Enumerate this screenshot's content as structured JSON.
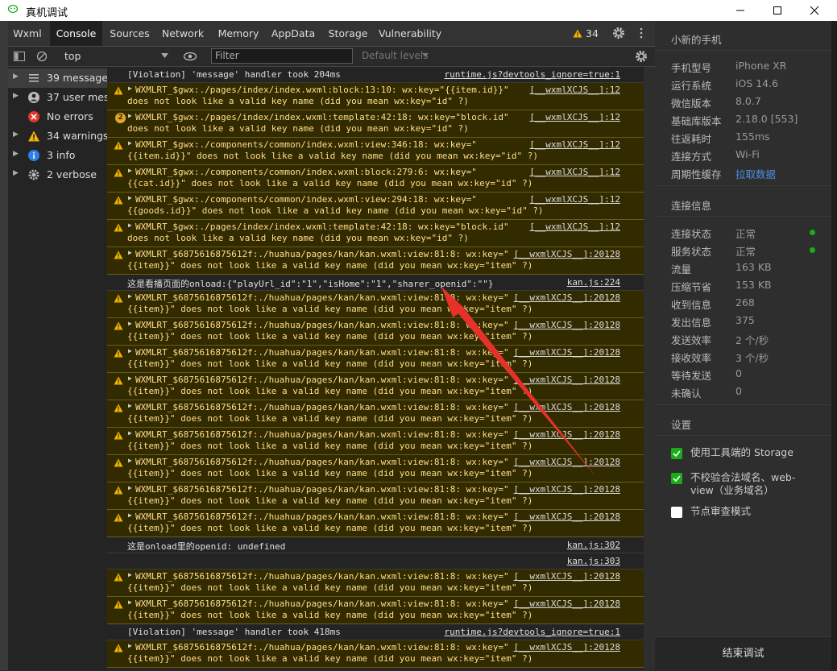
{
  "window": {
    "title": "真机调试"
  },
  "tabs": [
    {
      "label": "Wxml"
    },
    {
      "label": "Console"
    },
    {
      "label": "Sources"
    },
    {
      "label": "Network"
    },
    {
      "label": "Memory"
    },
    {
      "label": "AppData"
    },
    {
      "label": "Storage"
    },
    {
      "label": "Vulnerability"
    }
  ],
  "warning_badge": "34",
  "toolbar": {
    "context": "top",
    "filter_placeholder": "Filter",
    "levels": "Default levels"
  },
  "sidebar": [
    {
      "label": "39 messages",
      "icon": "list-icon"
    },
    {
      "label": "37 user mes...",
      "icon": "user-icon"
    },
    {
      "label": "No errors",
      "icon": "error-icon"
    },
    {
      "label": "34 warnings",
      "icon": "warning-icon"
    },
    {
      "label": "3 info",
      "icon": "info-icon"
    },
    {
      "label": "2 verbose",
      "icon": "gear-icon"
    }
  ],
  "console": [
    {
      "type": "plain",
      "text": "[Violation] 'message' handler took 204ms",
      "src": "runtime.js?devtools_ignore=true:1"
    },
    {
      "type": "warn",
      "line1": "WXMLRT_$gwx:./pages/index/index.wxml:block:13:10: wx:key=\"{{item.id}}\"",
      "line2": "does not look like a valid key name (did you mean wx:key=\"id\" ?)",
      "src": "[__wxmlXCJS__]:12"
    },
    {
      "type": "warn2",
      "badge": "2",
      "line1": "WXMLRT_$gwx:./pages/index/index.wxml:template:42:18: wx:key=\"block.id\"",
      "line2": "does not look like a valid key name (did you mean wx:key=\"id\" ?)",
      "src": "[__wxmlXCJS__]:12"
    },
    {
      "type": "warn",
      "line1": "WXMLRT_$gwx:./components/common/index.wxml:view:346:18: wx:key=\"",
      "line2": "{{item.id}}\" does not look like a valid key name (did you mean wx:key=\"id\" ?)",
      "src": "[__wxmlXCJS__]:12"
    },
    {
      "type": "warn",
      "line1": "WXMLRT_$gwx:./components/common/index.wxml:block:279:6: wx:key=\"",
      "line2": "{{cat.id}}\" does not look like a valid key name (did you mean wx:key=\"id\" ?)",
      "src": "[__wxmlXCJS__]:12"
    },
    {
      "type": "warn",
      "line1": "WXMLRT_$gwx:./components/common/index.wxml:view:294:18: wx:key=\"",
      "line2": "{{goods.id}}\" does not look like a valid key name (did you mean wx:key=\"id\" ?)",
      "src": "[__wxmlXCJS__]:12"
    },
    {
      "type": "warn",
      "line1": "WXMLRT_$gwx:./pages/index/index.wxml:template:42:18: wx:key=\"block.id\"",
      "line2": "does not look like a valid key name (did you mean wx:key=\"id\" ?)",
      "src": "[__wxmlXCJS__]:12"
    },
    {
      "type": "warn",
      "line1": "WXMLRT_$6875616875612f:./huahua/pages/kan/kan.wxml:view:81:8: wx:key=\"",
      "line2": "{{item}}\" does not look like a valid key name (did you mean wx:key=\"item\" ?)",
      "src": "[__wxmlXCJS__]:20128"
    },
    {
      "type": "plain",
      "text": "这是看播页面的onload:{\"playUrl_id\":\"1\",\"isHome\":\"1\",\"sharer_openid\":\"\"}",
      "src": "kan.js:224"
    },
    {
      "type": "warn",
      "line1": "WXMLRT_$6875616875612f:./huahua/pages/kan/kan.wxml:view:81:8: wx:key=\"",
      "line2": "{{item}}\" does not look like a valid key name (did you mean wx:key=\"item\" ?)",
      "src": "[__wxmlXCJS__]:20128"
    },
    {
      "type": "warn",
      "line1": "WXMLRT_$6875616875612f:./huahua/pages/kan/kan.wxml:view:81:8: wx:key=\"",
      "line2": "{{item}}\" does not look like a valid key name (did you mean wx:key=\"item\" ?)",
      "src": "[__wxmlXCJS__]:20128"
    },
    {
      "type": "warn",
      "line1": "WXMLRT_$6875616875612f:./huahua/pages/kan/kan.wxml:view:81:8: wx:key=\"",
      "line2": "{{item}}\" does not look like a valid key name (did you mean wx:key=\"item\" ?)",
      "src": "[__wxmlXCJS__]:20128"
    },
    {
      "type": "warn",
      "line1": "WXMLRT_$6875616875612f:./huahua/pages/kan/kan.wxml:view:81:8: wx:key=\"",
      "line2": "{{item}}\" does not look like a valid key name (did you mean wx:key=\"item\" ?)",
      "src": "[__wxmlXCJS__]:20128"
    },
    {
      "type": "warn",
      "line1": "WXMLRT_$6875616875612f:./huahua/pages/kan/kan.wxml:view:81:8: wx:key=\"",
      "line2": "{{item}}\" does not look like a valid key name (did you mean wx:key=\"item\" ?)",
      "src": "[__wxmlXCJS__]:20128"
    },
    {
      "type": "warn",
      "line1": "WXMLRT_$6875616875612f:./huahua/pages/kan/kan.wxml:view:81:8: wx:key=\"",
      "line2": "{{item}}\" does not look like a valid key name (did you mean wx:key=\"item\" ?)",
      "src": "[__wxmlXCJS__]:20128"
    },
    {
      "type": "warn",
      "line1": "WXMLRT_$6875616875612f:./huahua/pages/kan/kan.wxml:view:81:8: wx:key=\"",
      "line2": "{{item}}\" does not look like a valid key name (did you mean wx:key=\"item\" ?)",
      "src": "[__wxmlXCJS__]:20128"
    },
    {
      "type": "warn",
      "line1": "WXMLRT_$6875616875612f:./huahua/pages/kan/kan.wxml:view:81:8: wx:key=\"",
      "line2": "{{item}}\" does not look like a valid key name (did you mean wx:key=\"item\" ?)",
      "src": "[__wxmlXCJS__]:20128"
    },
    {
      "type": "warn",
      "line1": "WXMLRT_$6875616875612f:./huahua/pages/kan/kan.wxml:view:81:8: wx:key=\"",
      "line2": "{{item}}\" does not look like a valid key name (did you mean wx:key=\"item\" ?)",
      "src": "[__wxmlXCJS__]:20128"
    },
    {
      "type": "plain",
      "text": "这是onload里的openid: undefined",
      "src": "kan.js:302"
    },
    {
      "type": "plain",
      "text": "",
      "src": "kan.js:303"
    },
    {
      "type": "warn",
      "line1": "WXMLRT_$6875616875612f:./huahua/pages/kan/kan.wxml:view:81:8: wx:key=\"",
      "line2": "{{item}}\" does not look like a valid key name (did you mean wx:key=\"item\" ?)",
      "src": "[__wxmlXCJS__]:20128"
    },
    {
      "type": "warn",
      "line1": "WXMLRT_$6875616875612f:./huahua/pages/kan/kan.wxml:view:81:8: wx:key=\"",
      "line2": "{{item}}\" does not look like a valid key name (did you mean wx:key=\"item\" ?)",
      "src": "[__wxmlXCJS__]:20128"
    },
    {
      "type": "plain",
      "text": "[Violation] 'message' handler took 418ms",
      "src": "runtime.js?devtools_ignore=true:1"
    },
    {
      "type": "warn",
      "line1": "WXMLRT_$6875616875612f:./huahua/pages/kan/kan.wxml:view:81:8: wx:key=\"",
      "line2": "{{item}}\" does not look like a valid key name (did you mean wx:key=\"item\" ?)",
      "src": "[__wxmlXCJS__]:20128"
    }
  ],
  "panel": {
    "device_title": "小新的手机",
    "info": [
      {
        "k": "手机型号",
        "v": "iPhone XR"
      },
      {
        "k": "运行系统",
        "v": "iOS 14.6"
      },
      {
        "k": "微信版本",
        "v": "8.0.7"
      },
      {
        "k": "基础库版本",
        "v": "2.18.0 [553]"
      },
      {
        "k": "往返耗时",
        "v": "155ms"
      },
      {
        "k": "连接方式",
        "v": "Wi-Fi"
      },
      {
        "k": "周期性缓存",
        "v": "拉取数据",
        "link": true
      }
    ],
    "conn_title": "连接信息",
    "conn": [
      {
        "k": "连接状态",
        "v": "正常",
        "dot": true
      },
      {
        "k": "服务状态",
        "v": "正常",
        "dot": true
      },
      {
        "k": "流量",
        "v": "163 KB"
      },
      {
        "k": "压缩节省",
        "v": "153 KB"
      },
      {
        "k": "收到信息",
        "v": "268"
      },
      {
        "k": "发出信息",
        "v": "375"
      },
      {
        "k": "发送效率",
        "v": "2 个/秒"
      },
      {
        "k": "接收效率",
        "v": "3 个/秒"
      },
      {
        "k": "等待发送",
        "v": "0"
      },
      {
        "k": "未确认",
        "v": "0"
      }
    ],
    "settings_title": "设置",
    "settings": [
      {
        "label": "使用工具端的 Storage",
        "checked": true
      },
      {
        "label": "不校验合法域名、web-view（业务域名）",
        "checked": true
      },
      {
        "label": "节点审查模式",
        "checked": false
      }
    ],
    "end_button": "结束调试"
  },
  "colors": {
    "warn_bg": "#332b00",
    "warn_text": "#ffdd8c",
    "accent": "#1aad19",
    "link": "#4a90e2",
    "arrow": "#e8302a"
  }
}
